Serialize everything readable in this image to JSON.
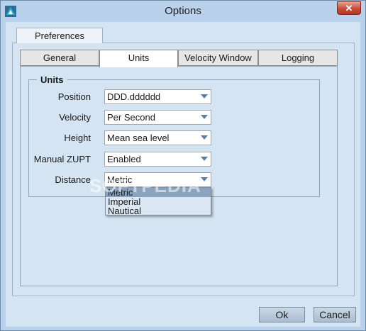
{
  "window": {
    "title": "Options",
    "close_label": "✕"
  },
  "outer_tab": {
    "label": "Preferences"
  },
  "tabs": [
    {
      "label": "General"
    },
    {
      "label": "Units"
    },
    {
      "label": "Velocity Window"
    },
    {
      "label": "Logging"
    }
  ],
  "active_tab": "Units",
  "units_group": {
    "title": "Units",
    "rows": [
      {
        "label": "Position",
        "value": "DDD.dddddd"
      },
      {
        "label": "Velocity",
        "value": "Per Second"
      },
      {
        "label": "Height",
        "value": "Mean sea level"
      },
      {
        "label": "Manual ZUPT",
        "value": "Enabled"
      },
      {
        "label": "Distance",
        "value": "Metric"
      }
    ],
    "distance_options": [
      "Metric",
      "Imperial",
      "Nautical"
    ],
    "distance_selected_option": "Metric"
  },
  "watermark": "SOFTPEDIA",
  "buttons": {
    "ok": "Ok",
    "cancel": "Cancel"
  },
  "colors": {
    "window_bg": "#b9d1ea",
    "client_bg": "#d4e4f2",
    "close_red": "#c44e3a",
    "selection": "#8aa4be"
  }
}
